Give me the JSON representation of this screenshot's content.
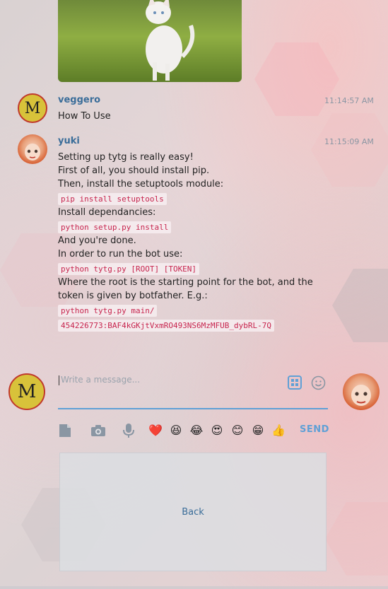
{
  "photo": {
    "alt": "kitten photo"
  },
  "messages": [
    {
      "sender": "veggero",
      "time": "11:14:57 AM",
      "text": "How To Use"
    },
    {
      "sender": "yuki",
      "time": "11:15:09 AM",
      "lines": [
        "Setting up tytg is really easy!",
        "First of all, you should install pip.",
        "Then, install the setuptools module:",
        "Install dependancies:",
        "And you're done.",
        "In order to run the bot use:",
        "Where the root is the starting point for the bot, and the",
        "token is given by botfather. E.g.:"
      ],
      "code": [
        "pip install setuptools",
        "python setup.py install",
        "python tytg.py [ROOT] [TOKEN]",
        "python tytg.py main/",
        "454226773:BAF4kGKjtVxmRO493NS6MzMFUB_dybRL-7Q"
      ]
    }
  ],
  "composer": {
    "placeholder": "Write a message...",
    "send_label": "SEND",
    "emojis": [
      "❤️",
      "😆",
      "😂",
      "😍",
      "😊",
      "😁",
      "👍"
    ]
  },
  "panel": {
    "back_label": "Back"
  },
  "avatars": {
    "veggero": "M"
  },
  "colors": {
    "accent": "#5fa0d6",
    "sender": "#3a6d99",
    "code": "#c7254e"
  }
}
